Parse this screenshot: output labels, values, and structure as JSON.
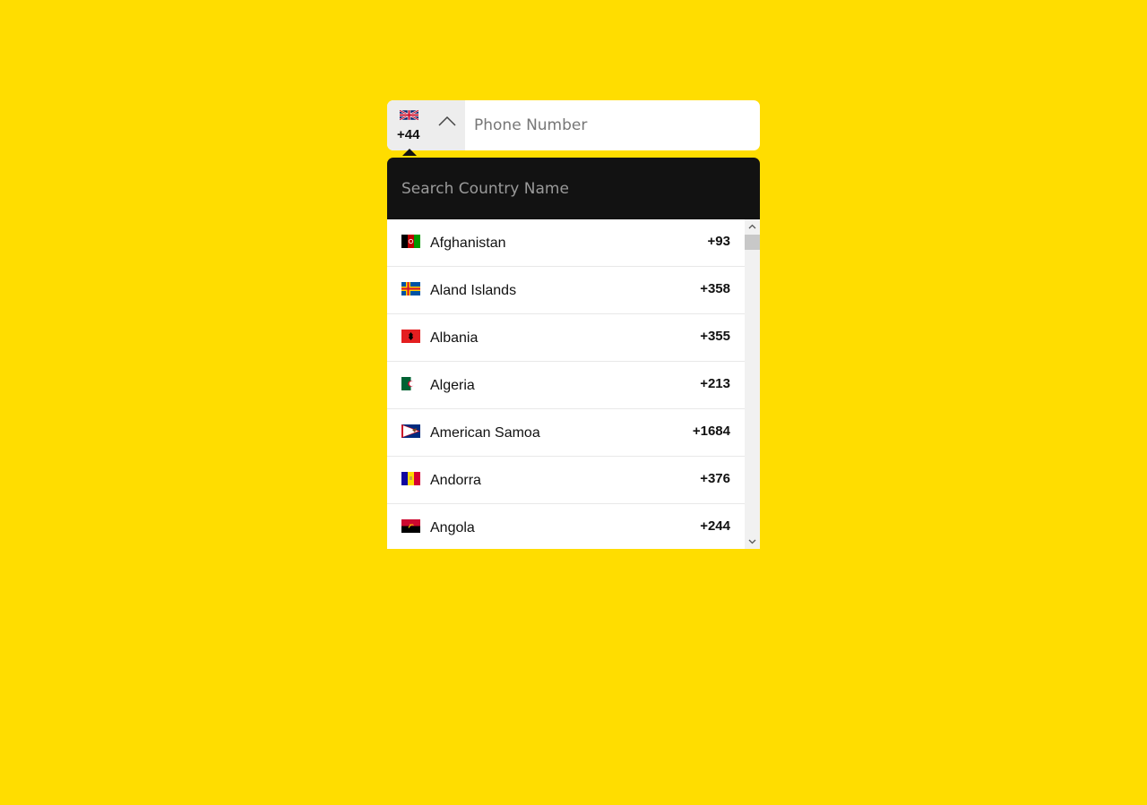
{
  "selector": {
    "flag_icon": "united-kingdom-flag-icon",
    "code": "+44"
  },
  "phone": {
    "placeholder": "Phone Number",
    "value": ""
  },
  "search": {
    "placeholder": "Search Country Name",
    "value": ""
  },
  "countries": [
    {
      "name": "Afghanistan",
      "code": "+93",
      "flag_icon": "afghanistan-flag-icon"
    },
    {
      "name": "Aland Islands",
      "code": "+358",
      "flag_icon": "aland-islands-flag-icon"
    },
    {
      "name": "Albania",
      "code": "+355",
      "flag_icon": "albania-flag-icon"
    },
    {
      "name": "Algeria",
      "code": "+213",
      "flag_icon": "algeria-flag-icon"
    },
    {
      "name": "American Samoa",
      "code": "+1684",
      "flag_icon": "american-samoa-flag-icon"
    },
    {
      "name": "Andorra",
      "code": "+376",
      "flag_icon": "andorra-flag-icon"
    },
    {
      "name": "Angola",
      "code": "+244",
      "flag_icon": "angola-flag-icon"
    }
  ],
  "colors": {
    "background": "#ffdd00",
    "search_bar": "#121212",
    "selector_bg": "#ededed"
  }
}
